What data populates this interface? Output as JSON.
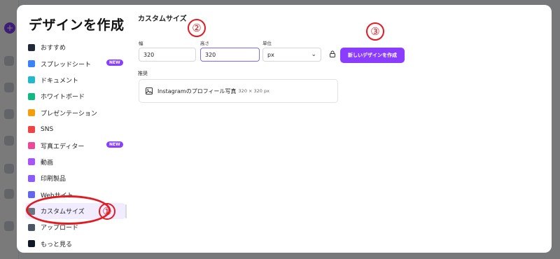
{
  "modal": {
    "title": "デザインを作成",
    "menu": [
      {
        "label": "おすすめ",
        "icon": "sparkle-icon",
        "color": "#1f2937",
        "badge": ""
      },
      {
        "label": "スプレッドシート",
        "icon": "spreadsheet-icon",
        "color": "#3b82f6",
        "badge": "NEW"
      },
      {
        "label": "ドキュメント",
        "icon": "document-icon",
        "color": "#22b8cf",
        "badge": ""
      },
      {
        "label": "ホワイトボード",
        "icon": "whiteboard-icon",
        "color": "#10b981",
        "badge": ""
      },
      {
        "label": "プレゼンテーション",
        "icon": "presentation-icon",
        "color": "#f59e0b",
        "badge": ""
      },
      {
        "label": "SNS",
        "icon": "heart-icon",
        "color": "#ef4444",
        "badge": ""
      },
      {
        "label": "写真エディター",
        "icon": "camera-icon",
        "color": "#ec4899",
        "badge": "NEW"
      },
      {
        "label": "動画",
        "icon": "video-icon",
        "color": "#a855f7",
        "badge": ""
      },
      {
        "label": "印刷製品",
        "icon": "print-icon",
        "color": "#8b5cf6",
        "badge": ""
      },
      {
        "label": "Webサイト",
        "icon": "website-icon",
        "color": "#6366f1",
        "badge": ""
      },
      {
        "label": "カスタムサイズ",
        "icon": "resize-icon",
        "color": "#6b7280",
        "badge": ""
      },
      {
        "label": "アップロード",
        "icon": "upload-cloud-icon",
        "color": "#4b5563",
        "badge": ""
      },
      {
        "label": "もっと見る",
        "icon": "more-icon",
        "color": "#111827",
        "badge": ""
      }
    ],
    "custom": {
      "heading": "カスタムサイズ",
      "width_label": "幅",
      "width_value": "320",
      "height_label": "高さ",
      "height_value": "320",
      "unit_label": "単位",
      "unit_value": "px",
      "create_button": "新しいデザインを作成",
      "recommend_label": "推奨",
      "recommend_item": "Instagramのプロフィール写真",
      "recommend_dims": "320 × 320 px"
    }
  },
  "annotations": {
    "one": "①",
    "two": "②",
    "three": "③"
  },
  "colors": {
    "accent": "#8b3dff",
    "annotation": "#e21b23"
  }
}
